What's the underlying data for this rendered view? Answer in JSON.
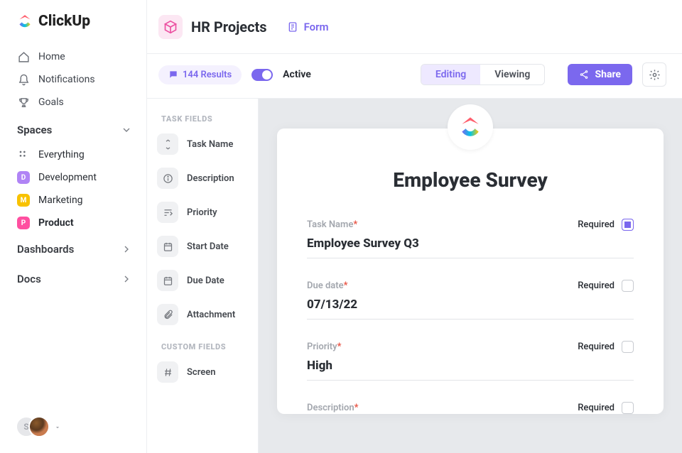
{
  "brand": "ClickUp",
  "nav": {
    "home": "Home",
    "notifications": "Notifications",
    "goals": "Goals"
  },
  "spaces": {
    "header": "Spaces",
    "items": [
      {
        "label": "Everything",
        "dots": true
      },
      {
        "label": "Development",
        "badge": "D",
        "color": "#b084f5"
      },
      {
        "label": "Marketing",
        "badge": "M",
        "color": "#f8c200"
      },
      {
        "label": "Product",
        "badge": "P",
        "color": "#ff4fa0",
        "active": true
      }
    ]
  },
  "sections": {
    "dashboards": "Dashboards",
    "docs": "Docs"
  },
  "topbar": {
    "project": "HR Projects",
    "tab_form": "Form"
  },
  "toolbar": {
    "results": "144 Results",
    "active": "Active",
    "mode_editing": "Editing",
    "mode_viewing": "Viewing",
    "share": "Share"
  },
  "fields_panel": {
    "task_header": "TASK FIELDS",
    "items": [
      "Task Name",
      "Description",
      "Priority",
      "Start Date",
      "Due Date",
      "Attachment"
    ],
    "custom_header": "CUSTOM FIELDS",
    "custom_items": [
      "Screen"
    ]
  },
  "form": {
    "title": "Employee Survey",
    "required_label": "Required",
    "fields": [
      {
        "label": "Task Name",
        "value": "Employee Survey Q3",
        "checked": true
      },
      {
        "label": "Due date",
        "value": "07/13/22",
        "checked": false
      },
      {
        "label": "Priority",
        "value": "High",
        "checked": false
      },
      {
        "label": "Description",
        "value": "",
        "checked": false
      }
    ]
  }
}
